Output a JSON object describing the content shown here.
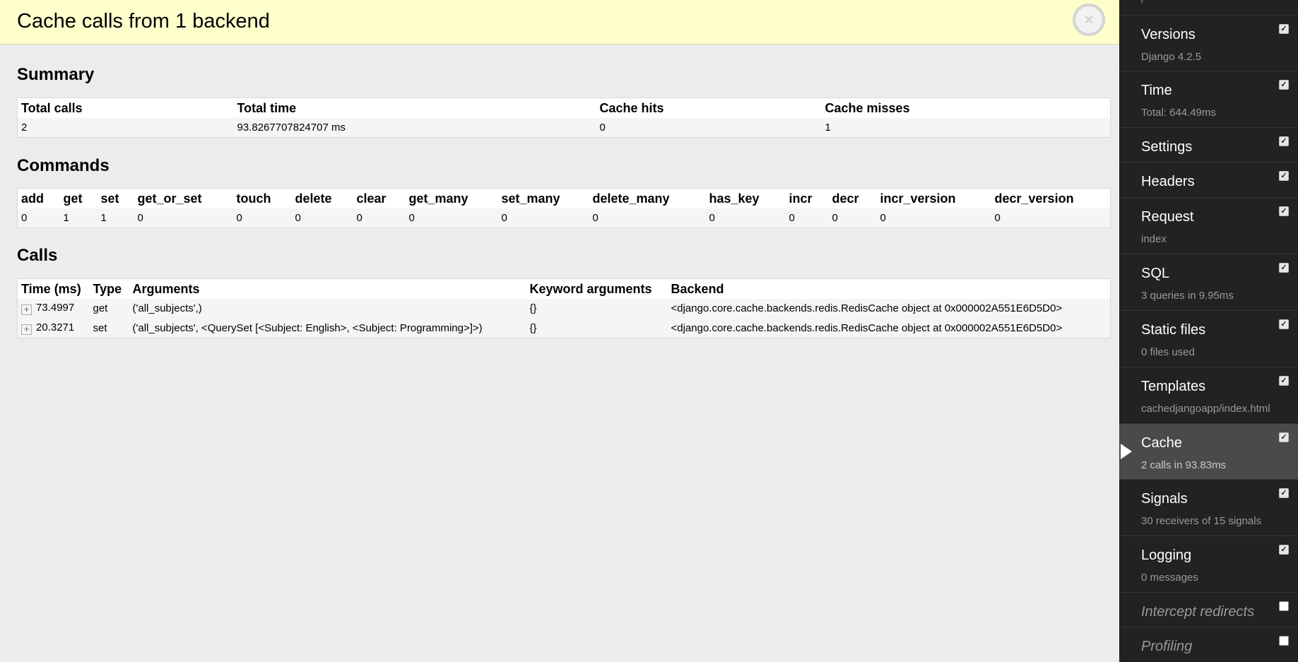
{
  "panel": {
    "title": "Cache calls from 1 backend",
    "close_icon": "×"
  },
  "summary": {
    "heading": "Summary",
    "columns": [
      "Total calls",
      "Total time",
      "Cache hits",
      "Cache misses"
    ],
    "row": [
      "2",
      "93.8267707824707 ms",
      "0",
      "1"
    ]
  },
  "commands": {
    "heading": "Commands",
    "columns": [
      "add",
      "get",
      "set",
      "get_or_set",
      "touch",
      "delete",
      "clear",
      "get_many",
      "set_many",
      "delete_many",
      "has_key",
      "incr",
      "decr",
      "incr_version",
      "decr_version"
    ],
    "row": [
      "0",
      "1",
      "1",
      "0",
      "0",
      "0",
      "0",
      "0",
      "0",
      "0",
      "0",
      "0",
      "0",
      "0",
      "0"
    ]
  },
  "calls": {
    "heading": "Calls",
    "columns": [
      "Time (ms)",
      "Type",
      "Arguments",
      "Keyword arguments",
      "Backend"
    ],
    "expand_icon": "+",
    "rows": [
      {
        "time": "73.4997",
        "type": "get",
        "args": "('all_subjects',)",
        "kwargs": "{}",
        "backend": "<django.core.cache.backends.redis.RedisCache object at 0x000002A551E6D5D0>"
      },
      {
        "time": "20.3271",
        "type": "set",
        "args": "('all_subjects', <QuerySet [<Subject: English>, <Subject: Programming>]>)",
        "kwargs": "{}",
        "backend": "<django.core.cache.backends.redis.RedisCache object at 0x000002A551E6D5D0>"
      }
    ]
  },
  "sidebar": {
    "top_fragment": "/",
    "check_glyph": "✓",
    "items": [
      {
        "label": "Versions",
        "sub": "Django 4.2.5",
        "checked": true
      },
      {
        "label": "Time",
        "sub": "Total: 644.49ms",
        "checked": true
      },
      {
        "label": "Settings",
        "sub": "",
        "checked": true
      },
      {
        "label": "Headers",
        "sub": "",
        "checked": true
      },
      {
        "label": "Request",
        "sub": "index",
        "checked": true
      },
      {
        "label": "SQL",
        "sub": "3 queries in 9.95ms",
        "checked": true
      },
      {
        "label": "Static files",
        "sub": "0 files used",
        "checked": true
      },
      {
        "label": "Templates",
        "sub": "cachedjangoapp/index.html",
        "checked": true
      },
      {
        "label": "Cache",
        "sub": "2 calls in 93.83ms",
        "checked": true,
        "active": true
      },
      {
        "label": "Signals",
        "sub": "30 receivers of 15 signals",
        "checked": true
      },
      {
        "label": "Logging",
        "sub": "0 messages",
        "checked": true
      },
      {
        "label": "Intercept redirects",
        "sub": "",
        "checked": false
      },
      {
        "label": "Profiling",
        "sub": "",
        "checked": false
      }
    ]
  }
}
